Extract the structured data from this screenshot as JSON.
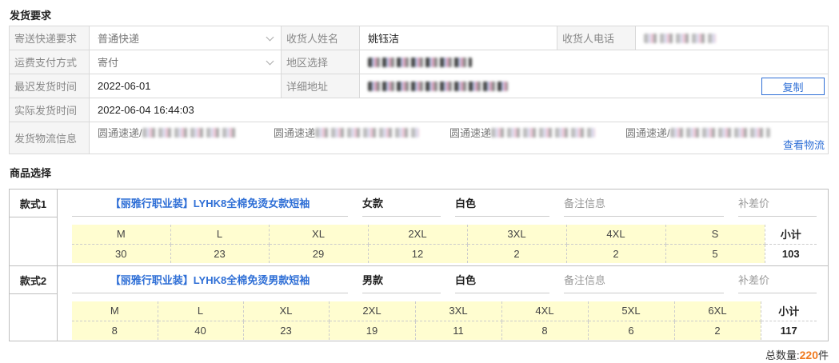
{
  "shipping_section": {
    "title": "发货要求",
    "express_label": "寄送快递要求",
    "express_value": "普通快递",
    "receiver_name_label": "收货人姓名",
    "receiver_name_value": "姚钰洁",
    "receiver_phone_label": "收货人电话",
    "freight_label": "运费支付方式",
    "freight_value": "寄付",
    "region_label": "地区选择",
    "latest_ship_label": "最迟发货时间",
    "latest_ship_value": "2022-06-01",
    "address_label": "详细地址",
    "copy_button": "复制",
    "actual_ship_label": "实际发货时间",
    "actual_ship_value": "2022-06-04 16:44:03",
    "logistics_label": "发货物流信息",
    "logistics_items": [
      "圆通速递/",
      "圆通速递",
      "圆通速递",
      "圆通速递/"
    ],
    "view_logistics": "查看物流"
  },
  "product_section": {
    "title": "商品选择",
    "styles": [
      {
        "label": "款式1",
        "name": "【丽雅行职业装】LYHK8全棉免烫女款短袖",
        "gender": "女款",
        "color": "白色",
        "note_placeholder": "备注信息",
        "price_placeholder": "补差价",
        "sizes": [
          "M",
          "L",
          "XL",
          "2XL",
          "3XL",
          "4XL",
          "S"
        ],
        "quantities": [
          "30",
          "23",
          "29",
          "12",
          "2",
          "2",
          "5"
        ],
        "subtotal_label": "小计",
        "subtotal": "103"
      },
      {
        "label": "款式2",
        "name": "【丽雅行职业装】LYHK8全棉免烫男款短袖",
        "gender": "男款",
        "color": "白色",
        "note_placeholder": "备注信息",
        "price_placeholder": "补差价",
        "sizes": [
          "M",
          "L",
          "XL",
          "2XL",
          "3XL",
          "4XL",
          "5XL",
          "6XL"
        ],
        "quantities": [
          "8",
          "40",
          "23",
          "19",
          "11",
          "8",
          "6",
          "2"
        ],
        "subtotal_label": "小计",
        "subtotal": "117"
      }
    ],
    "total_prefix": "总数量:",
    "total_value": "220",
    "total_unit": "件"
  }
}
